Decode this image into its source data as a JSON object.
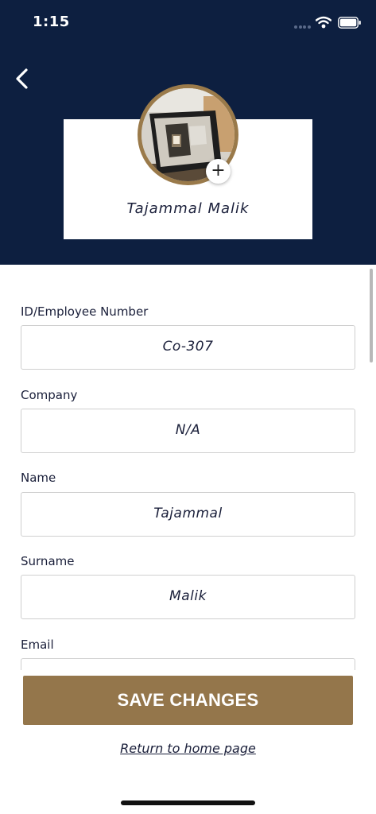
{
  "status_bar": {
    "time": "1:15"
  },
  "header": {
    "back_icon": "chevron-left-icon"
  },
  "profile": {
    "name": "Tajammal Malik",
    "add_photo_symbol": "+"
  },
  "form": {
    "employee_number": {
      "label": "ID/Employee Number",
      "value": "Co-307"
    },
    "company": {
      "label": "Company",
      "value": "N/A"
    },
    "name": {
      "label": "Name",
      "value": "Tajammal"
    },
    "surname": {
      "label": "Surname",
      "value": "Malik"
    },
    "email": {
      "label": "Email",
      "value": ""
    }
  },
  "actions": {
    "save_label": "SAVE CHANGES",
    "home_link": "Return to home page"
  },
  "colors": {
    "header_bg": "#0d1f40",
    "accent": "#94764b",
    "text": "#1a1f3a"
  }
}
